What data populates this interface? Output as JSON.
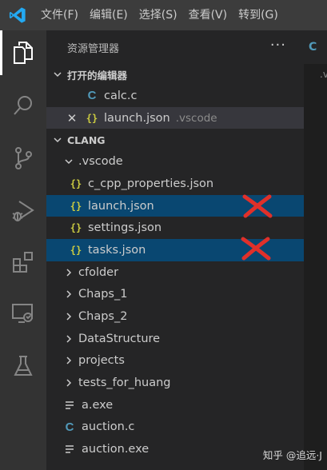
{
  "menu": [
    "文件(F)",
    "编辑(E)",
    "选择(S)",
    "查看(V)",
    "转到(G)"
  ],
  "activity_icons": [
    "explorer-icon",
    "search-icon",
    "source-control-icon",
    "run-debug-icon",
    "extensions-icon",
    "remote-explorer-icon",
    "testing-icon"
  ],
  "explorer": {
    "title": "资源管理器",
    "more": "···",
    "open_editors": {
      "label": "打开的编辑器",
      "items": [
        {
          "name": "calc.c",
          "type": "c"
        },
        {
          "name": "launch.json",
          "type": "json",
          "folder": ".vscode"
        }
      ]
    },
    "workspace": {
      "label": "CLANG",
      "vscode_folder": ".vscode",
      "vscode_files": [
        "c_cpp_properties.json",
        "launch.json",
        "settings.json",
        "tasks.json"
      ],
      "folders": [
        "cfolder",
        "Chaps_1",
        "Chaps_2",
        "DataStructure",
        "projects",
        "tests_for_huang"
      ],
      "files": [
        {
          "name": "a.exe",
          "type": "exe"
        },
        {
          "name": "auction.c",
          "type": "c"
        },
        {
          "name": "auction.exe",
          "type": "exe"
        }
      ]
    }
  },
  "icons": {
    "json": "{}",
    "c": "C"
  },
  "editor": {
    "tab_fragment": "C",
    "breadcrumb_fragment": ".v"
  },
  "watermark": "知乎 @追远·J",
  "colors": {
    "selected": "#094771",
    "json_icon": "#cbcb41",
    "c_icon": "#519aba",
    "red_mark": "#e0302a",
    "logo": "#23a9f2"
  }
}
